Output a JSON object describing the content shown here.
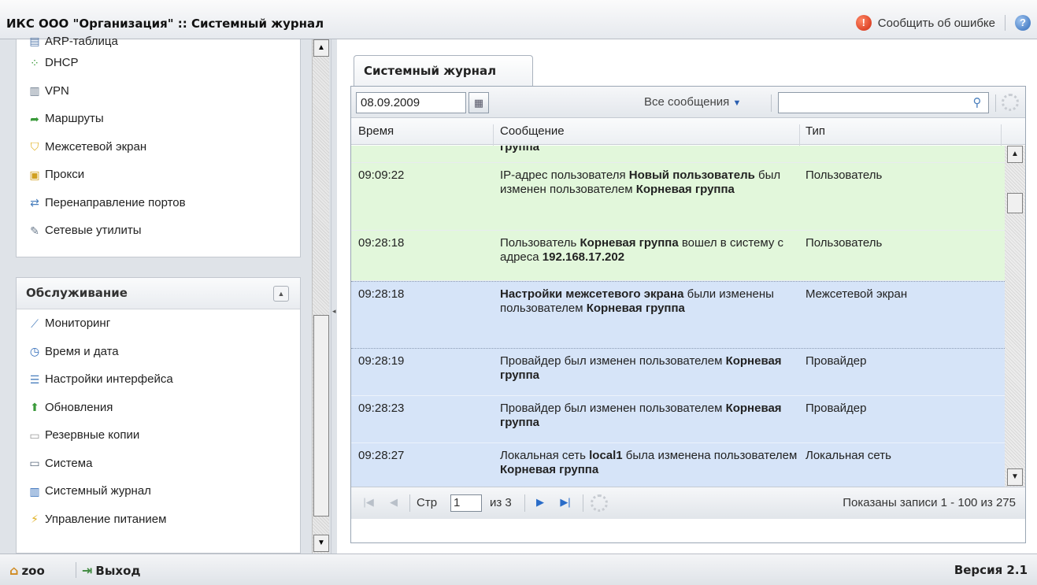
{
  "header": {
    "title": "ИКС ООО \"Организация\" :: Системный журнал",
    "report_label": "Сообщить об ошибке",
    "report_icon": "!",
    "help_icon": "?"
  },
  "sidebar": {
    "top_items": [
      {
        "label": "ARP-таблица",
        "icon": "table-icon"
      },
      {
        "label": "DHCP",
        "icon": "dhcp-icon"
      },
      {
        "label": "VPN",
        "icon": "vpn-icon"
      },
      {
        "label": "Маршруты",
        "icon": "routes-icon"
      },
      {
        "label": "Межсетевой экран",
        "icon": "shield-icon"
      },
      {
        "label": "Прокси",
        "icon": "lock-icon"
      },
      {
        "label": "Перенаправление портов",
        "icon": "port-forward-icon"
      },
      {
        "label": "Сетевые утилиты",
        "icon": "wrench-icon"
      }
    ],
    "section_title": "Обслуживание",
    "bottom_items": [
      {
        "label": "Мониторинг",
        "icon": "monitoring-icon"
      },
      {
        "label": "Время и дата",
        "icon": "clock-icon"
      },
      {
        "label": "Настройки интерфейса",
        "icon": "interface-icon"
      },
      {
        "label": "Обновления",
        "icon": "update-icon"
      },
      {
        "label": "Резервные копии",
        "icon": "backup-icon"
      },
      {
        "label": "Система",
        "icon": "system-icon"
      },
      {
        "label": "Системный журнал",
        "icon": "book-icon"
      },
      {
        "label": "Управление питанием",
        "icon": "power-icon"
      }
    ]
  },
  "main": {
    "tab_label": "Системный журнал",
    "toolbar": {
      "date_value": "08.09.2009",
      "filter_label": "Все сообщения",
      "search_value": ""
    },
    "columns": {
      "time": "Время",
      "message": "Сообщение",
      "type": "Тип"
    },
    "rows": [
      {
        "time": "",
        "color": "green",
        "type": "",
        "segments": [
          {
            "t": "группа",
            "b": true
          }
        ]
      },
      {
        "time": "09:09:22",
        "color": "green",
        "type": "Пользователь",
        "segments": [
          {
            "t": "IP-адрес пользователя ",
            "b": false
          },
          {
            "t": "Новый пользователь",
            "b": true
          },
          {
            "t": " был изменен пользователем ",
            "b": false
          },
          {
            "t": "Корневая группа",
            "b": true
          }
        ]
      },
      {
        "time": "09:28:18",
        "color": "green",
        "type": "Пользователь",
        "segments": [
          {
            "t": "Пользователь ",
            "b": false
          },
          {
            "t": "Корневая группа",
            "b": true
          },
          {
            "t": " вошел в систему с адреса ",
            "b": false
          },
          {
            "t": "192.168.17.202",
            "b": true
          }
        ]
      },
      {
        "time": "09:28:18",
        "color": "blue",
        "type": "Межсетевой экран",
        "segments": [
          {
            "t": "Настройки межсетевого экрана",
            "b": true
          },
          {
            "t": " были изменены пользователем ",
            "b": false
          },
          {
            "t": "Корневая группа",
            "b": true
          }
        ]
      },
      {
        "time": "09:28:19",
        "color": "blue",
        "type": "Провайдер",
        "segments": [
          {
            "t": "Провайдер был изменен пользователем ",
            "b": false
          },
          {
            "t": "Корневая группа",
            "b": true
          }
        ]
      },
      {
        "time": "09:28:23",
        "color": "blue",
        "type": "Провайдер",
        "segments": [
          {
            "t": "Провайдер был изменен пользователем ",
            "b": false
          },
          {
            "t": "Корневая группа",
            "b": true
          }
        ]
      },
      {
        "time": "09:28:27",
        "color": "blue",
        "type": "Локальная сеть",
        "segments": [
          {
            "t": "Локальная сеть ",
            "b": false
          },
          {
            "t": "local1",
            "b": true
          },
          {
            "t": " была изменена пользователем ",
            "b": false
          },
          {
            "t": "Корневая группа",
            "b": true
          }
        ]
      }
    ],
    "pager": {
      "page_label": "Стр",
      "page_value": "1",
      "of_label": "из 3",
      "summary": "Показаны записи 1 - 100 из 275"
    }
  },
  "footer": {
    "user_label": "zoo",
    "logout_label": "Выход",
    "version": "Версия 2.1"
  },
  "colors": {
    "row_green": "#e2f7db",
    "row_blue": "#d6e4f8",
    "accent": "#2a6cc8"
  }
}
